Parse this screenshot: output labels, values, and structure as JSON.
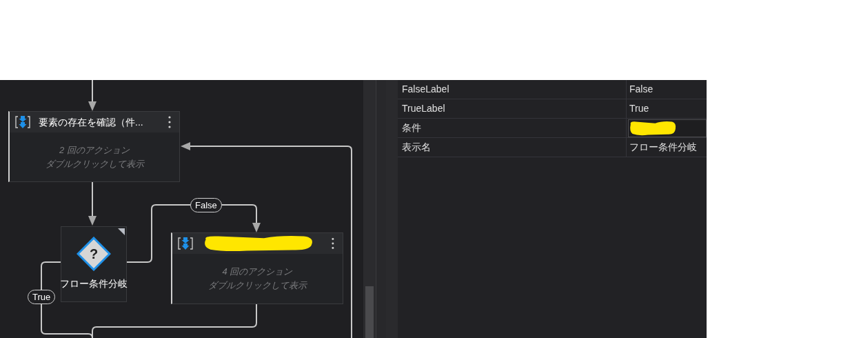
{
  "flow": {
    "nodes": [
      {
        "kind": "action_group",
        "title": "要素の存在を確認（件...",
        "redacted": false,
        "lines": [
          "2 回のアクション",
          "ダブルクリックして表示"
        ]
      },
      {
        "kind": "decision",
        "symbol": "?",
        "label": "フロー条件分岐"
      },
      {
        "kind": "action_group",
        "redacted": true,
        "lines": [
          "4 回のアクション",
          "ダブルクリックして表示"
        ]
      }
    ],
    "edge_labels": [
      {
        "kind": "false",
        "text": "False"
      },
      {
        "kind": "true",
        "text": "True"
      }
    ]
  },
  "properties": [
    {
      "name": "FalseLabel",
      "value": "False"
    },
    {
      "name": "TrueLabel",
      "value": "True"
    },
    {
      "name": "条件",
      "kind": "field",
      "redacted": true
    },
    {
      "name": "表示名",
      "value": "フロー条件分岐"
    }
  ]
}
